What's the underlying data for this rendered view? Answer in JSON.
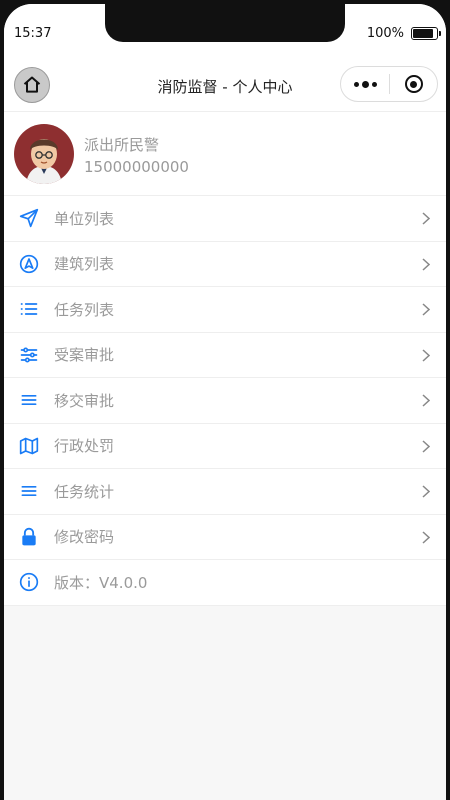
{
  "status_bar": {
    "time": "15:37",
    "battery_percent": "100%"
  },
  "nav": {
    "title": "消防监督 - 个人中心",
    "icons": [
      "home-icon",
      "more-icon",
      "close-mini-program-icon"
    ]
  },
  "profile": {
    "role": "派出所民警",
    "phone": "15000000000"
  },
  "menu": {
    "items": [
      {
        "label": "单位列表",
        "icon": "send-icon"
      },
      {
        "label": "建筑列表",
        "icon": "navigation-icon"
      },
      {
        "label": "任务列表",
        "icon": "list-icon"
      },
      {
        "label": "受案审批",
        "icon": "sliders-icon"
      },
      {
        "label": "移交审批",
        "icon": "menu-icon"
      },
      {
        "label": "行政处罚",
        "icon": "map-icon"
      },
      {
        "label": "任务统计",
        "icon": "menu-icon"
      },
      {
        "label": "修改密码",
        "icon": "lock-icon"
      },
      {
        "label": "版本：V4.0.0",
        "icon": "info-icon"
      }
    ]
  },
  "colors": {
    "accent": "#1a7cf5",
    "text_muted": "#9a9a9a",
    "background": "#f7f7f7"
  }
}
